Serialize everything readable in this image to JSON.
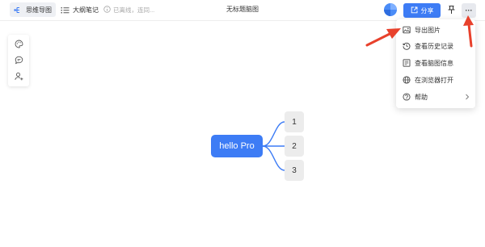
{
  "header": {
    "mode_tabs": [
      {
        "label": "思维导图",
        "icon": "mindmap-icon",
        "active": true
      },
      {
        "label": "大纲笔记",
        "icon": "outline-list-icon",
        "active": false
      }
    ],
    "save_status": "已离线，连同...",
    "doc_title": "无标题脑图",
    "share_label": "分享",
    "more_label": "···"
  },
  "left_toolbar": {
    "items": [
      {
        "icon": "palette-icon"
      },
      {
        "icon": "comment-icon"
      },
      {
        "icon": "user-add-icon"
      }
    ]
  },
  "more_menu": {
    "items": [
      {
        "label": "导出图片",
        "icon": "image-export-icon"
      },
      {
        "label": "查看历史记录",
        "icon": "history-icon"
      },
      {
        "label": "查看脑图信息",
        "icon": "info-doc-icon"
      },
      {
        "label": "在浏览器打开",
        "icon": "globe-icon"
      },
      {
        "label": "帮助",
        "icon": "help-icon",
        "has_submenu": true
      }
    ]
  },
  "mindmap": {
    "root": "hello Pro",
    "children": [
      "1",
      "2",
      "3"
    ]
  },
  "colors": {
    "accent": "#3d7cf5",
    "annotation": "#e8412c",
    "node_bg": "#ececec"
  }
}
